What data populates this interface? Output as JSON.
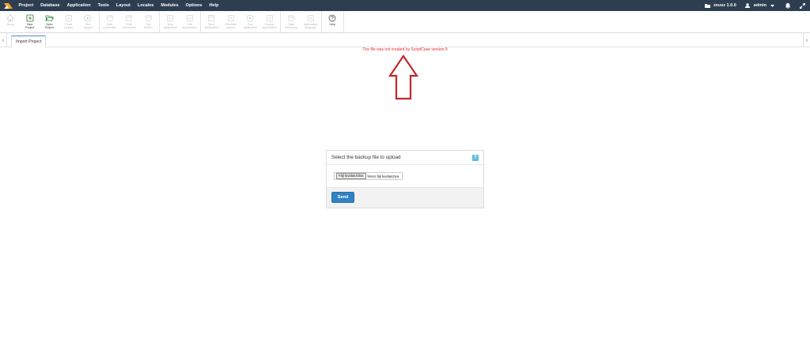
{
  "menubar": {
    "items": [
      "Project",
      "Database",
      "Application",
      "Tools",
      "Layout",
      "Locales",
      "Modules",
      "Options",
      "Help"
    ],
    "project_name": "zeusz 1.0.0",
    "user": "admin"
  },
  "toolbar": {
    "groups": [
      [
        {
          "label": "Home",
          "icon": "home-icon",
          "enabled": false
        },
        {
          "label": "New\nProject",
          "icon": "new-project-icon",
          "enabled": true
        },
        {
          "label": "Open\nProject",
          "icon": "folder-open-icon",
          "enabled": true
        },
        {
          "label": "Close\nproject",
          "icon": "close-project-icon",
          "enabled": false
        },
        {
          "label": "Run\nproject",
          "icon": "run-project-icon",
          "enabled": false
        }
      ],
      [
        {
          "label": "New\nconnection",
          "icon": "new-connection-icon",
          "enabled": false
        },
        {
          "label": "Edit\nconnection",
          "icon": "edit-connection-icon",
          "enabled": false
        },
        {
          "label": "SQL\nBuilder",
          "icon": "sql-builder-icon",
          "enabled": false
        }
      ],
      [
        {
          "label": "New\napplication",
          "icon": "new-application-icon",
          "enabled": false
        },
        {
          "label": "Edit\napplications",
          "icon": "edit-applications-icon",
          "enabled": false
        }
      ],
      [
        {
          "label": "Save\napplication",
          "icon": "save-icon",
          "enabled": false
        },
        {
          "label": "Generate\nsource",
          "icon": "generate-icon",
          "enabled": false
        },
        {
          "label": "Run\napplication",
          "icon": "run-icon",
          "enabled": false
        },
        {
          "label": "Deploy\napplications",
          "icon": "deploy-icon",
          "enabled": false
        }
      ],
      [
        {
          "label": "Data\nDictionary",
          "icon": "data-dictionary-icon",
          "enabled": false
        },
        {
          "label": "Application\nlanguage",
          "icon": "language-icon",
          "enabled": false
        }
      ],
      [
        {
          "label": "Help",
          "icon": "help-icon",
          "enabled": true
        }
      ]
    ]
  },
  "tabs": {
    "active": "Import Project"
  },
  "message": {
    "error": "The file was not created by ScriptCase version 9"
  },
  "upload": {
    "title": "Select the backup file to upload",
    "help": "?",
    "file_button": "Fájl kiválasztása",
    "file_status": "Nincs fájl kiválasztva",
    "send": "Send"
  },
  "colors": {
    "menubar": "#2d3e50",
    "error": "#e03030",
    "arrow": "#c0282d",
    "send": "#2f82c3",
    "help_badge": "#5bc0de"
  }
}
